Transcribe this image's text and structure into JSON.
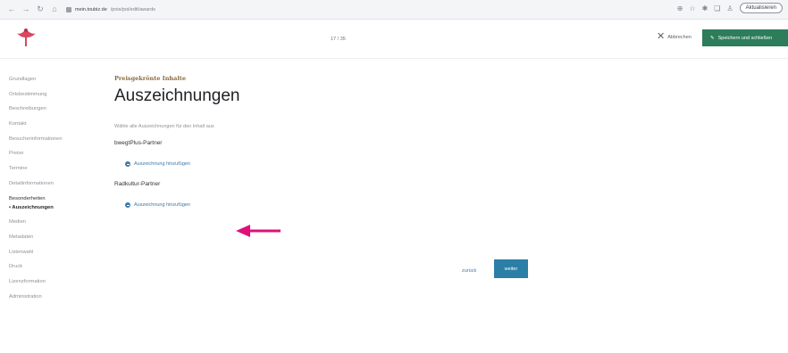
{
  "browser": {
    "url_host": "mein.toubiz.de",
    "url_path": "/pois/poi/edit/awards",
    "update_label": "Aktualisieren"
  },
  "header": {
    "progress": "17 / 35",
    "cancel_label": "Abbrechen",
    "save_label": "Speichern und schließen"
  },
  "sidebar": {
    "items": [
      {
        "label": "Grundlagen"
      },
      {
        "label": "Ortsbestimmung"
      },
      {
        "label": "Beschreibungen"
      },
      {
        "label": "Kontakt"
      },
      {
        "label": "Besucherinformationen"
      },
      {
        "label": "Preise"
      },
      {
        "label": "Termine"
      },
      {
        "label": "Detailinformationen"
      },
      {
        "label": "Besonderheiten"
      }
    ],
    "sub_active": "• Auszeichnungen",
    "items_after": [
      {
        "label": "Medien"
      },
      {
        "label": "Metadaten"
      },
      {
        "label": "Listenwahl"
      },
      {
        "label": "Druck"
      },
      {
        "label": "Lizenzformation"
      },
      {
        "label": "Administration"
      }
    ]
  },
  "main": {
    "eyebrow": "Preisgekrönte Inhalte",
    "title": "Auszeichnungen",
    "intro": "Wähle alle Auszeichnungen für den Inhalt aus",
    "groups": [
      {
        "label": "bwegtPlus-Partner",
        "add_label": "Auszeichnung hinzufügen"
      },
      {
        "label": "Radkultur-Partner",
        "add_label": "Auszeichnung hinzufügen"
      }
    ]
  },
  "footer": {
    "back_label": "zurück",
    "next_label": "weiter"
  },
  "colors": {
    "save_green": "#2d7d5b",
    "next_blue": "#2b7fa6",
    "link_blue": "#3d78a8",
    "eyebrow_brown": "#8a6b3e",
    "arrow_magenta": "#e0107a"
  },
  "icons": {
    "logo": "ladybug-logo-icon",
    "cancel": "close-icon",
    "save": "pencil-icon",
    "add": "plus-circle-icon",
    "annotation": "arrow-left-icon"
  }
}
